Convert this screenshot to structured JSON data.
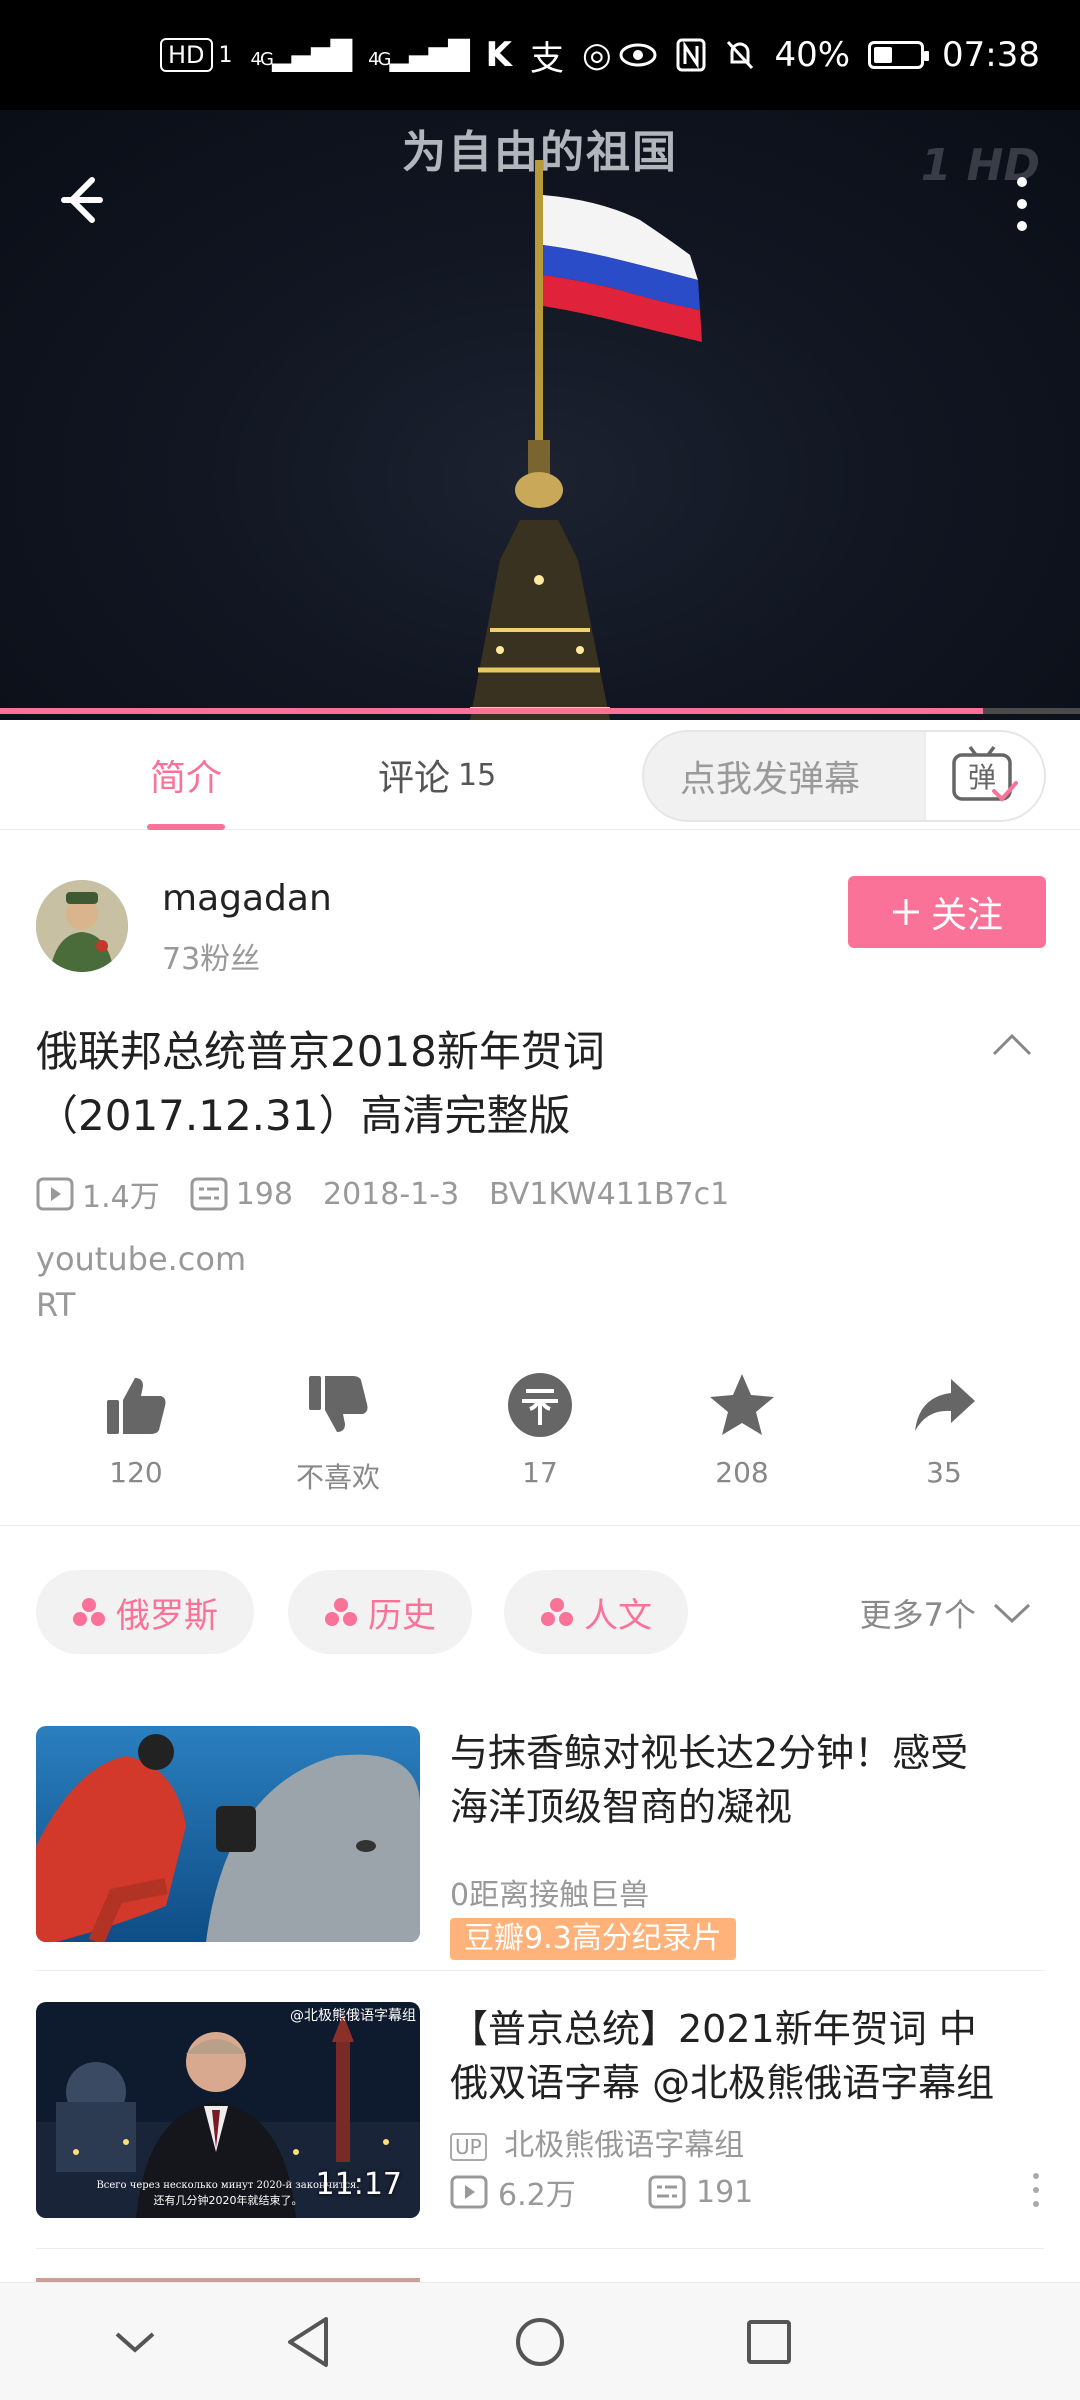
{
  "status_bar": {
    "hd_label": "HD",
    "sim_label": "1",
    "signal1": "4G",
    "signal2": "4G",
    "battery_percent": "40%",
    "time": "07:38"
  },
  "video": {
    "subtitle": "为自由的祖国",
    "channel_logo": "1 HD",
    "progress": 0.91
  },
  "tabs": {
    "intro": "简介",
    "comments_label": "评论",
    "comments_count": "15",
    "danmaku_placeholder": "点我发弹幕",
    "danmaku_glyph": "弹"
  },
  "author": {
    "name": "magadan",
    "fans": "73粉丝",
    "follow_label": "关注"
  },
  "title": {
    "line1": "俄联邦总统普京2018新年贺词",
    "line2": "（2017.12.31）高清完整版"
  },
  "meta": {
    "plays": "1.4万",
    "danmaku": "198",
    "date": "2018-1-3",
    "bvid": "BV1KW411B7c1"
  },
  "source": {
    "line1": "youtube.com",
    "line2": "RT"
  },
  "actions": {
    "like": "120",
    "dislike": "不喜欢",
    "coin": "17",
    "favorite": "208",
    "share": "35"
  },
  "tags": {
    "items": [
      "俄罗斯",
      "历史",
      "人文"
    ],
    "more": "更多7个"
  },
  "recommended": [
    {
      "title_line1": "与抹香鲸对视长达2分钟！感受",
      "title_line2": "海洋顶级智商的凝视",
      "subtitle": "0距离接触巨兽",
      "badge": "豆瓣9.3高分纪录片"
    },
    {
      "title_line1": "【普京总统】2021新年贺词 中",
      "title_line2": "俄双语字幕 @北极熊俄语字幕组",
      "up_label": "UP",
      "uploader": "北极熊俄语字幕组",
      "plays": "6.2万",
      "danmaku": "191",
      "duration": "11:17",
      "thumb_watermark": "@北极熊俄语字幕组",
      "thumb_caption_ru": "Всего через несколько минут 2020-й закончится.",
      "thumb_caption_zh": "还有几分钟2020年就结束了。"
    }
  ],
  "colors": {
    "accent": "#fb7299",
    "badge": "#ffb27a"
  }
}
